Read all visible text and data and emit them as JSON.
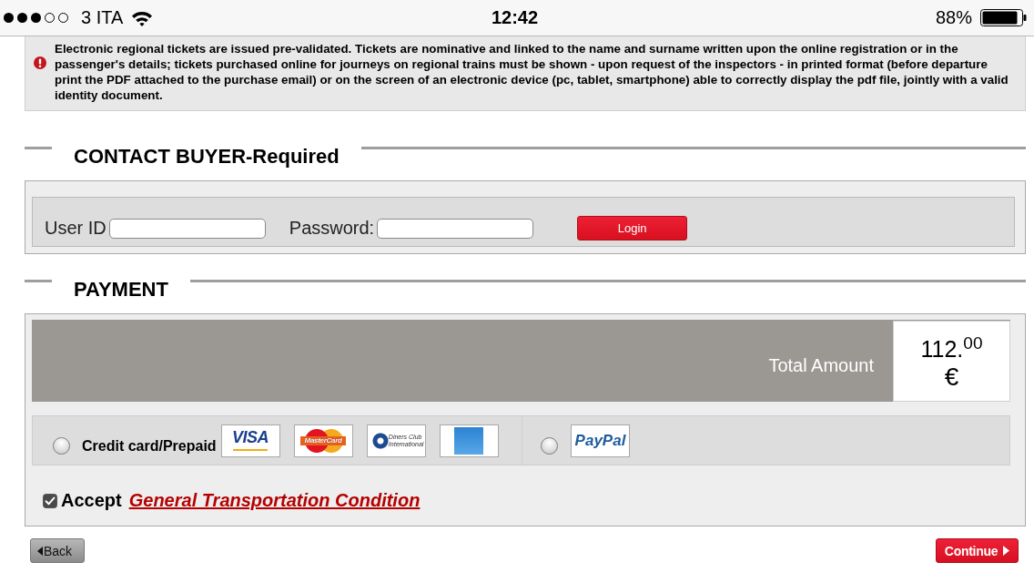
{
  "status_bar": {
    "carrier": "3 ITA",
    "time": "12:42",
    "battery": "88%"
  },
  "notice": {
    "text": "Electronic regional tickets are issued pre-validated. Tickets are nominative and linked to the name and surname written upon the online registration or in the passenger's details; tickets purchased online for journeys on regional trains must be shown - upon request of the inspectors - in printed format (before departure print the PDF attached to the purchase email) or on the screen of an electronic device (pc, tablet, smartphone) able to correctly display the pdf file, jointly with a valid identity document."
  },
  "contact_buyer": {
    "title": "CONTACT BUYER-Required",
    "user_id_label": "User ID",
    "password_label": "Password:",
    "login_button": "Login"
  },
  "payment": {
    "title": "PAYMENT",
    "total_label": "Total Amount",
    "total_amount": "112.$^{00}$",
    "currency": "€",
    "methods": [
      {
        "selected": false,
        "label": "Credit card/Prepaid",
        "logos": [
          {
            "kind": "visa",
            "text": "VISA"
          },
          {
            "kind": "mastercard",
            "text": "MasterCard"
          },
          {
            "kind": "diners",
            "text": "Diners Club International"
          },
          {
            "kind": "amex"
          }
        ]
      },
      {
        "selected": false,
        "logos": [
          {
            "kind": "paypal",
            "text": "PayPal"
          }
        ]
      }
    ],
    "accept": {
      "checked": true,
      "label": "Accept",
      "link": "General Transportation Condition"
    }
  },
  "buttons": {
    "back": "Back",
    "continue": "Continue"
  }
}
